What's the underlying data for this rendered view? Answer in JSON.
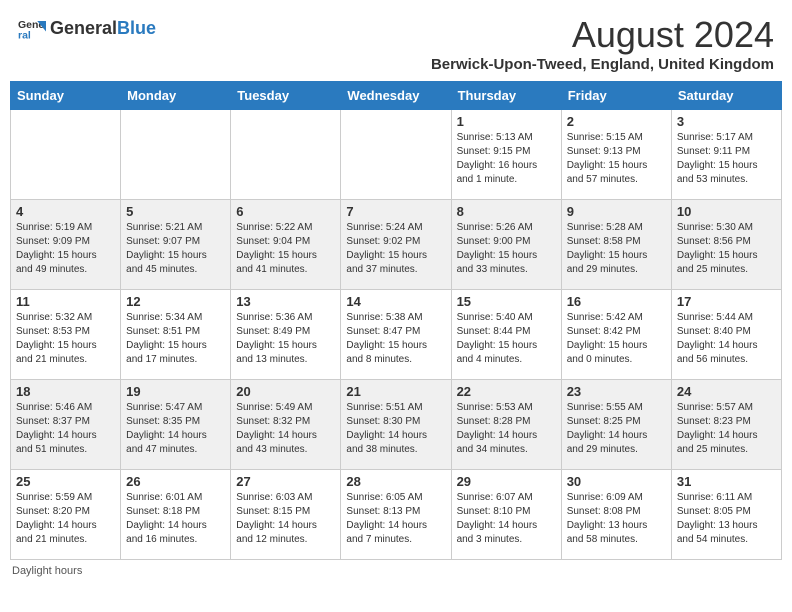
{
  "header": {
    "logo_general": "General",
    "logo_blue": "Blue",
    "month_year": "August 2024",
    "location": "Berwick-Upon-Tweed, England, United Kingdom"
  },
  "days_of_week": [
    "Sunday",
    "Monday",
    "Tuesday",
    "Wednesday",
    "Thursday",
    "Friday",
    "Saturday"
  ],
  "footer": {
    "daylight_label": "Daylight hours"
  },
  "weeks": [
    [
      {
        "day": "",
        "info": ""
      },
      {
        "day": "",
        "info": ""
      },
      {
        "day": "",
        "info": ""
      },
      {
        "day": "",
        "info": ""
      },
      {
        "day": "1",
        "info": "Sunrise: 5:13 AM\nSunset: 9:15 PM\nDaylight: 16 hours\nand 1 minute."
      },
      {
        "day": "2",
        "info": "Sunrise: 5:15 AM\nSunset: 9:13 PM\nDaylight: 15 hours\nand 57 minutes."
      },
      {
        "day": "3",
        "info": "Sunrise: 5:17 AM\nSunset: 9:11 PM\nDaylight: 15 hours\nand 53 minutes."
      }
    ],
    [
      {
        "day": "4",
        "info": "Sunrise: 5:19 AM\nSunset: 9:09 PM\nDaylight: 15 hours\nand 49 minutes."
      },
      {
        "day": "5",
        "info": "Sunrise: 5:21 AM\nSunset: 9:07 PM\nDaylight: 15 hours\nand 45 minutes."
      },
      {
        "day": "6",
        "info": "Sunrise: 5:22 AM\nSunset: 9:04 PM\nDaylight: 15 hours\nand 41 minutes."
      },
      {
        "day": "7",
        "info": "Sunrise: 5:24 AM\nSunset: 9:02 PM\nDaylight: 15 hours\nand 37 minutes."
      },
      {
        "day": "8",
        "info": "Sunrise: 5:26 AM\nSunset: 9:00 PM\nDaylight: 15 hours\nand 33 minutes."
      },
      {
        "day": "9",
        "info": "Sunrise: 5:28 AM\nSunset: 8:58 PM\nDaylight: 15 hours\nand 29 minutes."
      },
      {
        "day": "10",
        "info": "Sunrise: 5:30 AM\nSunset: 8:56 PM\nDaylight: 15 hours\nand 25 minutes."
      }
    ],
    [
      {
        "day": "11",
        "info": "Sunrise: 5:32 AM\nSunset: 8:53 PM\nDaylight: 15 hours\nand 21 minutes."
      },
      {
        "day": "12",
        "info": "Sunrise: 5:34 AM\nSunset: 8:51 PM\nDaylight: 15 hours\nand 17 minutes."
      },
      {
        "day": "13",
        "info": "Sunrise: 5:36 AM\nSunset: 8:49 PM\nDaylight: 15 hours\nand 13 minutes."
      },
      {
        "day": "14",
        "info": "Sunrise: 5:38 AM\nSunset: 8:47 PM\nDaylight: 15 hours\nand 8 minutes."
      },
      {
        "day": "15",
        "info": "Sunrise: 5:40 AM\nSunset: 8:44 PM\nDaylight: 15 hours\nand 4 minutes."
      },
      {
        "day": "16",
        "info": "Sunrise: 5:42 AM\nSunset: 8:42 PM\nDaylight: 15 hours\nand 0 minutes."
      },
      {
        "day": "17",
        "info": "Sunrise: 5:44 AM\nSunset: 8:40 PM\nDaylight: 14 hours\nand 56 minutes."
      }
    ],
    [
      {
        "day": "18",
        "info": "Sunrise: 5:46 AM\nSunset: 8:37 PM\nDaylight: 14 hours\nand 51 minutes."
      },
      {
        "day": "19",
        "info": "Sunrise: 5:47 AM\nSunset: 8:35 PM\nDaylight: 14 hours\nand 47 minutes."
      },
      {
        "day": "20",
        "info": "Sunrise: 5:49 AM\nSunset: 8:32 PM\nDaylight: 14 hours\nand 43 minutes."
      },
      {
        "day": "21",
        "info": "Sunrise: 5:51 AM\nSunset: 8:30 PM\nDaylight: 14 hours\nand 38 minutes."
      },
      {
        "day": "22",
        "info": "Sunrise: 5:53 AM\nSunset: 8:28 PM\nDaylight: 14 hours\nand 34 minutes."
      },
      {
        "day": "23",
        "info": "Sunrise: 5:55 AM\nSunset: 8:25 PM\nDaylight: 14 hours\nand 29 minutes."
      },
      {
        "day": "24",
        "info": "Sunrise: 5:57 AM\nSunset: 8:23 PM\nDaylight: 14 hours\nand 25 minutes."
      }
    ],
    [
      {
        "day": "25",
        "info": "Sunrise: 5:59 AM\nSunset: 8:20 PM\nDaylight: 14 hours\nand 21 minutes."
      },
      {
        "day": "26",
        "info": "Sunrise: 6:01 AM\nSunset: 8:18 PM\nDaylight: 14 hours\nand 16 minutes."
      },
      {
        "day": "27",
        "info": "Sunrise: 6:03 AM\nSunset: 8:15 PM\nDaylight: 14 hours\nand 12 minutes."
      },
      {
        "day": "28",
        "info": "Sunrise: 6:05 AM\nSunset: 8:13 PM\nDaylight: 14 hours\nand 7 minutes."
      },
      {
        "day": "29",
        "info": "Sunrise: 6:07 AM\nSunset: 8:10 PM\nDaylight: 14 hours\nand 3 minutes."
      },
      {
        "day": "30",
        "info": "Sunrise: 6:09 AM\nSunset: 8:08 PM\nDaylight: 13 hours\nand 58 minutes."
      },
      {
        "day": "31",
        "info": "Sunrise: 6:11 AM\nSunset: 8:05 PM\nDaylight: 13 hours\nand 54 minutes."
      }
    ]
  ]
}
